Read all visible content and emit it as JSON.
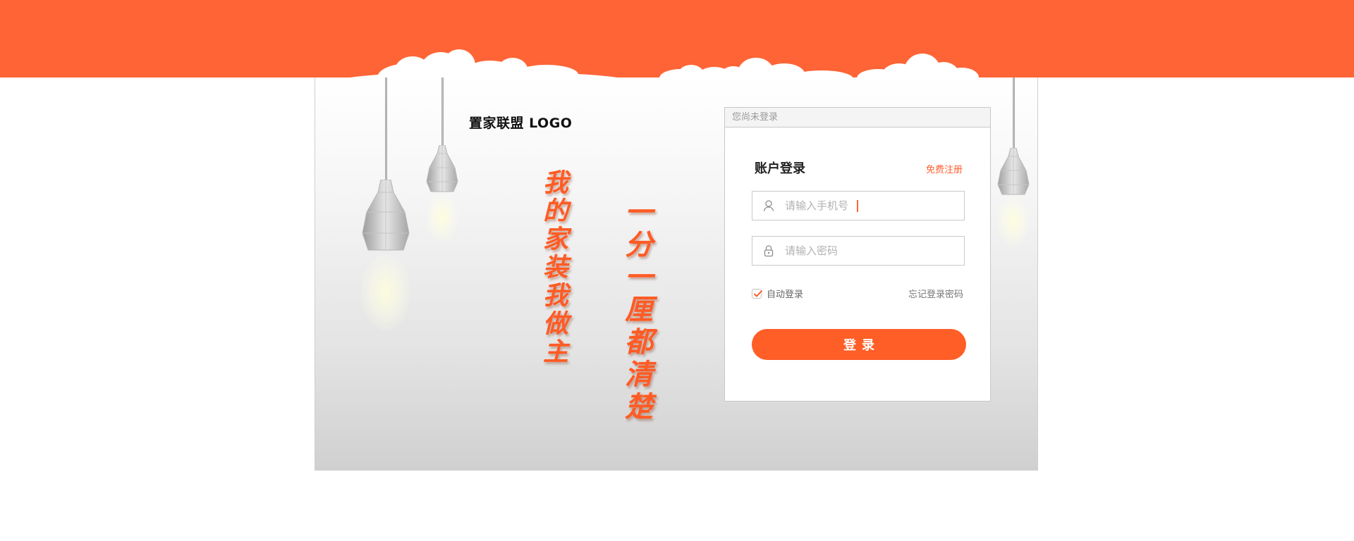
{
  "brand": {
    "logo_text": "置家联盟 LOGO",
    "accent_color": "#ff6436"
  },
  "slogans": {
    "left": "我的家装我做主",
    "right": "一分一厘都清楚"
  },
  "login": {
    "status_text": "您尚未登录",
    "title": "账户登录",
    "register_label": "免费注册",
    "phone_placeholder": "请输入手机号",
    "password_placeholder": "请输入密码",
    "remember_label": "自动登录",
    "remember_checked": true,
    "forgot_label": "忘记登录密码",
    "submit_label": "登录",
    "icons": {
      "phone": "user-icon",
      "password": "lock-icon",
      "remember": "checkmark-icon"
    }
  }
}
